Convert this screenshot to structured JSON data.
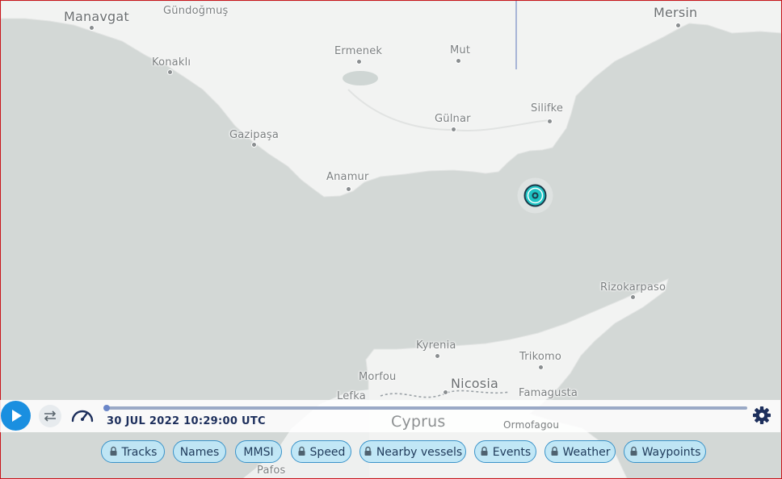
{
  "map": {
    "places": [
      {
        "id": "manavgat",
        "label": "Manavgat",
        "type": "city"
      },
      {
        "id": "gundogmus",
        "label": "Gündoğmuş",
        "type": "town"
      },
      {
        "id": "konakli",
        "label": "Konaklı",
        "type": "town"
      },
      {
        "id": "ermenek",
        "label": "Ermenek",
        "type": "town"
      },
      {
        "id": "mut",
        "label": "Mut",
        "type": "town"
      },
      {
        "id": "mersin",
        "label": "Mersin",
        "type": "city"
      },
      {
        "id": "silifke",
        "label": "Silifke",
        "type": "town"
      },
      {
        "id": "gulnar",
        "label": "Gülnar",
        "type": "town"
      },
      {
        "id": "gazipasa",
        "label": "Gazipaşa",
        "type": "town"
      },
      {
        "id": "anamur",
        "label": "Anamur",
        "type": "town"
      },
      {
        "id": "rizokarpaso",
        "label": "Rizokarpaso",
        "type": "town"
      },
      {
        "id": "kyrenia",
        "label": "Kyrenia",
        "type": "town"
      },
      {
        "id": "trikomo",
        "label": "Trikomo",
        "type": "town"
      },
      {
        "id": "morfou",
        "label": "Morfou",
        "type": "town"
      },
      {
        "id": "nicosia",
        "label": "Nicosia",
        "type": "city"
      },
      {
        "id": "lefka",
        "label": "Lefka",
        "type": "town"
      },
      {
        "id": "famagusta",
        "label": "Famagusta",
        "type": "town"
      },
      {
        "id": "cyprus",
        "label": "Cyprus",
        "type": "country"
      },
      {
        "id": "ormofagou",
        "label": "Ormofagou",
        "type": "town"
      },
      {
        "id": "pafos",
        "label": "Pafos",
        "type": "town"
      }
    ],
    "colors": {
      "sea": "#d3d8d6",
      "land": "#f2f3f2",
      "vessel": "#1fc4c4"
    }
  },
  "timeline": {
    "timestamp": "30 JUL 2022 10:29:00 UTC",
    "progress": 0.0,
    "play_icon": "play-icon",
    "loop_icon": "repeat-icon",
    "speed_icon": "speedometer-icon",
    "settings_icon": "gear-icon"
  },
  "layers": [
    {
      "id": "tracks",
      "label": "Tracks",
      "locked": true
    },
    {
      "id": "names",
      "label": "Names",
      "locked": false
    },
    {
      "id": "mmsi",
      "label": "MMSI",
      "locked": false
    },
    {
      "id": "speed",
      "label": "Speed",
      "locked": true
    },
    {
      "id": "nearby",
      "label": "Nearby vessels",
      "locked": true
    },
    {
      "id": "events",
      "label": "Events",
      "locked": true
    },
    {
      "id": "weather",
      "label": "Weather",
      "locked": true
    },
    {
      "id": "waypoints",
      "label": "Waypoints",
      "locked": true
    }
  ]
}
